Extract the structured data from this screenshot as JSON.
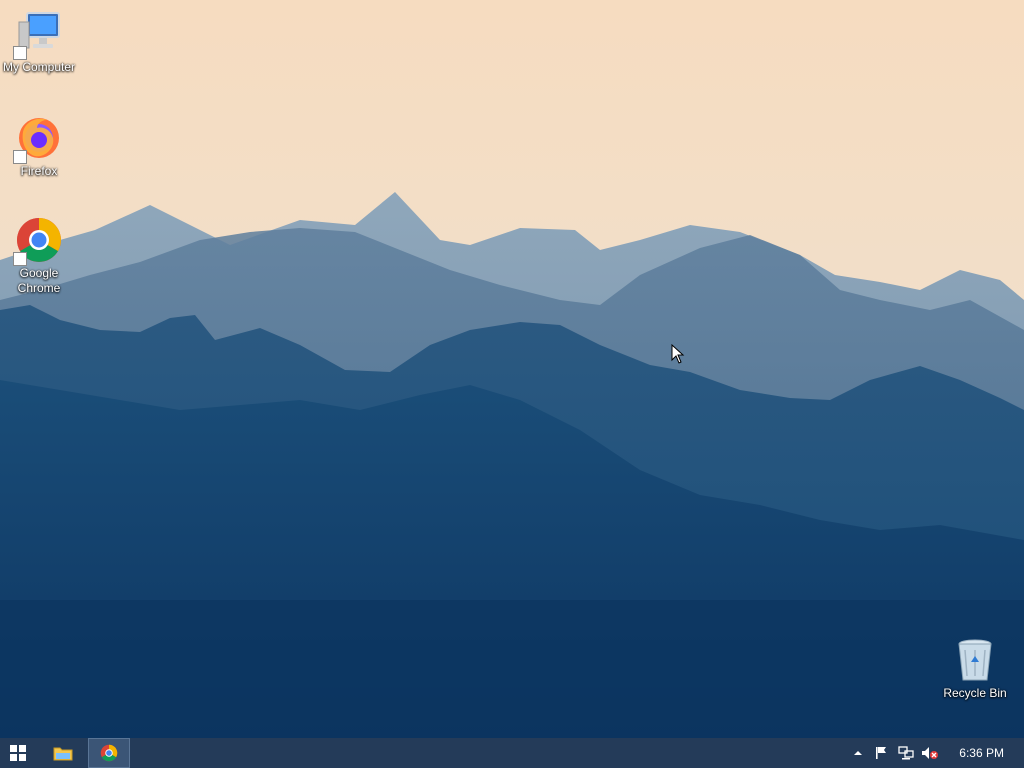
{
  "desktop": {
    "icons": [
      {
        "label": "My Computer",
        "icon": "computer-icon"
      },
      {
        "label": "Firefox",
        "icon": "firefox-icon"
      },
      {
        "label": "Google Chrome",
        "icon": "chrome-icon"
      },
      {
        "label": "Recycle Bin",
        "icon": "recycle-bin-icon"
      }
    ]
  },
  "taskbar": {
    "start_icon": "windows-start-icon",
    "pinned": [
      "file-explorer-icon",
      "chrome-icon"
    ],
    "active_app": "Google Chrome",
    "tray_icons": [
      "show-hidden-icons-arrow",
      "action-center-flag-icon",
      "network-icon",
      "volume-muted-icon"
    ],
    "clock": "6:36 PM"
  },
  "colors": {
    "taskbar": "#243b59",
    "sky": "#f4ddc2",
    "mountains_far": "#6f8aa3",
    "mountains_near": "#0f3c66"
  }
}
